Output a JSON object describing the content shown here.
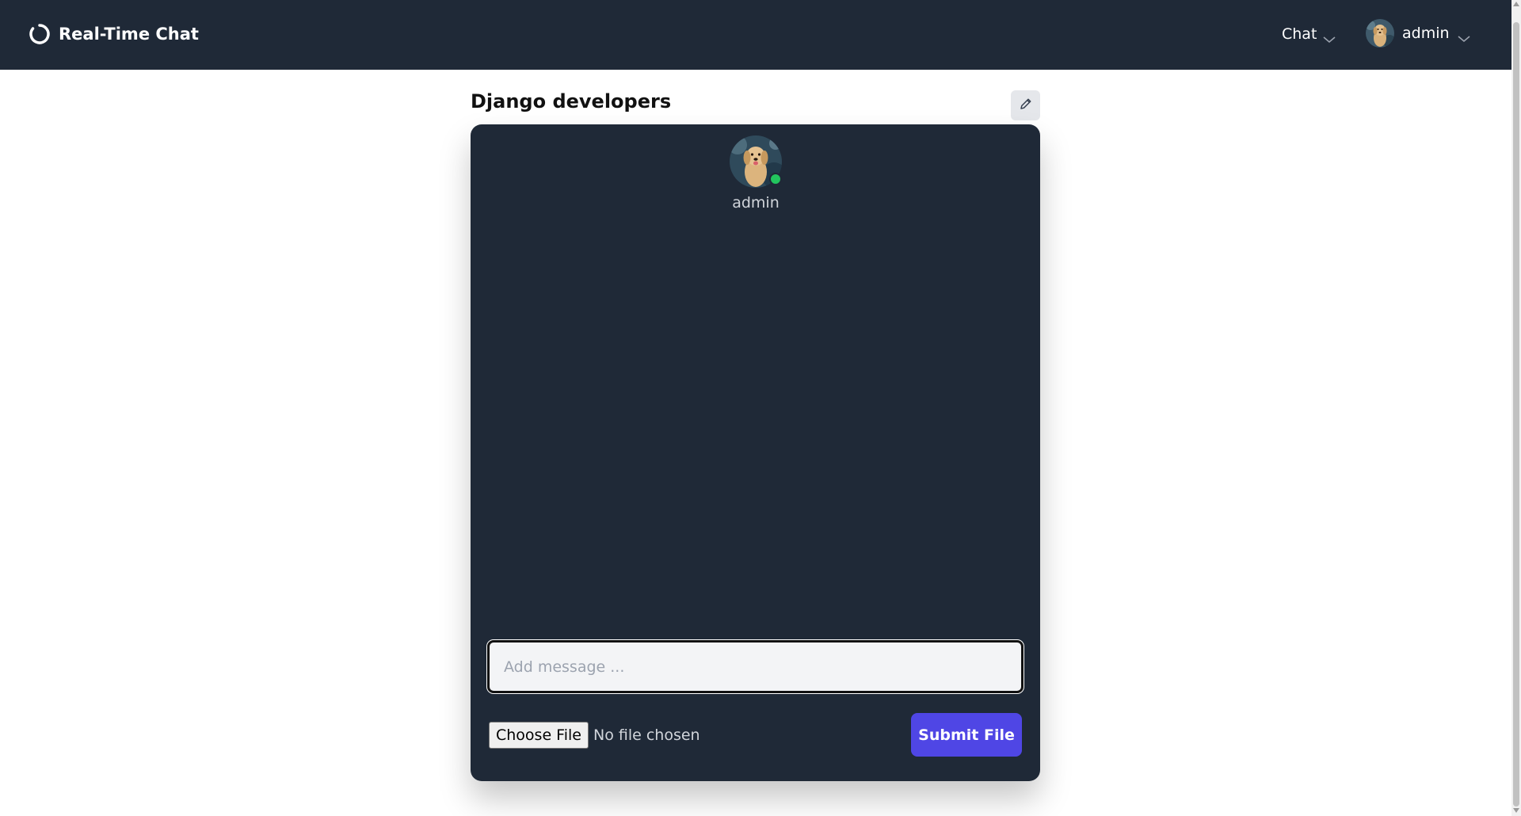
{
  "header": {
    "brand_title": "Real-Time Chat",
    "brand_icon": "spinner-ring-icon",
    "nav": {
      "chat_label": "Chat",
      "user_label": "admin"
    }
  },
  "room": {
    "title": "Django developers",
    "edit_icon": "pencil-icon",
    "online_users": [
      {
        "name": "admin",
        "status": "online"
      }
    ],
    "message_input": {
      "placeholder": "Add message ...",
      "value": ""
    },
    "file_upload": {
      "choose_label": "Choose File",
      "status_text": "No file chosen",
      "submit_label": "Submit File"
    }
  },
  "colors": {
    "header_bg": "#1f2937",
    "panel_bg": "#1f2937",
    "accent": "#4f46e5",
    "online": "#22c55e"
  }
}
